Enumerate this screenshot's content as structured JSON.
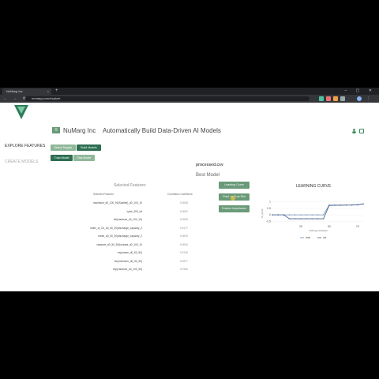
{
  "browser": {
    "tab_title": "NuMarg Inc",
    "tab_close": "×",
    "new_tab": "+",
    "window_controls": "‒ ▢ ✕",
    "nav_controls": "← → ⟳",
    "url": "numarg.com/explore"
  },
  "header": {
    "menu_icon": "hamburger-icon",
    "company": "NuMarg Inc",
    "title": "Automatically Build Data-Driven AI Models",
    "user_icon": "user-icon",
    "logout_icon": "logout-icon"
  },
  "sidebar": {
    "explore": "EXPLORE FEATURES",
    "create": "CREATE MODELS"
  },
  "toolbar": {
    "select_targets": "Select Targets",
    "build_models": "Build Models",
    "train_model": "Train Model",
    "test_model": "Test Model"
  },
  "main": {
    "file_name": "processed.csv",
    "best_model": "Best Model",
    "selected_features_title": "Selected Features",
    "col_features": "Selected Features",
    "col_coef": "Correlation Coefficient",
    "rows": [
      {
        "feature": "maximum_d0_100_90(Subtitle)_d0_100_10",
        "coef": "0.0008"
      },
      {
        "feature": "cycle_300_inf",
        "coef": "0.0002"
      },
      {
        "feature": "kfc(variance_d0_100_10)",
        "coef": "0.0006"
      },
      {
        "feature": "index_of_Ch_d0_50_90(discharge_capacity_2",
        "coef": "0.9177"
      },
      {
        "feature": "mean_d0_50_90(discharge_capacity_2",
        "coef": "0.0009"
      },
      {
        "feature": "variance_d0_50_90(kurtosis_d0_100_10",
        "coef": "0.0004"
      },
      {
        "feature": "exp(mean_d0_50_90)",
        "coef": "0.0746"
      },
      {
        "feature": "kfc(minimum_d0_50_90)",
        "coef": "0.0977"
      },
      {
        "feature": "exp(variance_d0_100_90)",
        "coef": "0.7906"
      }
    ],
    "buttons": {
      "learning_curve": "Learning Curve",
      "pred_vs_true": "Pred. vs True Plot",
      "feature_importance": "Feature Importance"
    }
  },
  "colors": {
    "accent_dark": "#2e6e52",
    "accent_light": "#6a9a78",
    "train_line": "#6f8fb5",
    "val_line": "#3d5f8f"
  },
  "chart_data": {
    "type": "line",
    "title": "LEARNING CURVE",
    "xlabel": "training examples",
    "ylabel": "R_score",
    "xlim": [
      0,
      80
    ],
    "ylim": [
      -0.6,
      1.1
    ],
    "xticks": [
      "25",
      "50",
      "75"
    ],
    "yticks": [
      "1",
      "0.5",
      "0",
      "-0.5"
    ],
    "legend_position": "bottom",
    "series": [
      {
        "name": "train",
        "x": [
          0,
          5,
          10,
          15,
          20,
          25,
          30,
          35,
          40,
          45,
          50,
          55,
          60,
          65,
          70,
          75,
          80
        ],
        "values": [
          0,
          0,
          0,
          0,
          0,
          0,
          0,
          0,
          0,
          0,
          0.75,
          0.75,
          0.75,
          0.75,
          0.76,
          0.78,
          0.85
        ]
      },
      {
        "name": "val",
        "x": [
          0,
          5,
          10,
          15,
          20,
          25,
          30,
          35,
          40,
          45,
          50,
          55,
          60,
          65,
          70,
          75,
          80
        ],
        "values": [
          0,
          0,
          0,
          -0.3,
          -0.3,
          -0.3,
          -0.3,
          -0.3,
          -0.3,
          -0.3,
          0.72,
          0.74,
          0.74,
          0.75,
          0.75,
          0.77,
          0.84
        ]
      }
    ]
  }
}
